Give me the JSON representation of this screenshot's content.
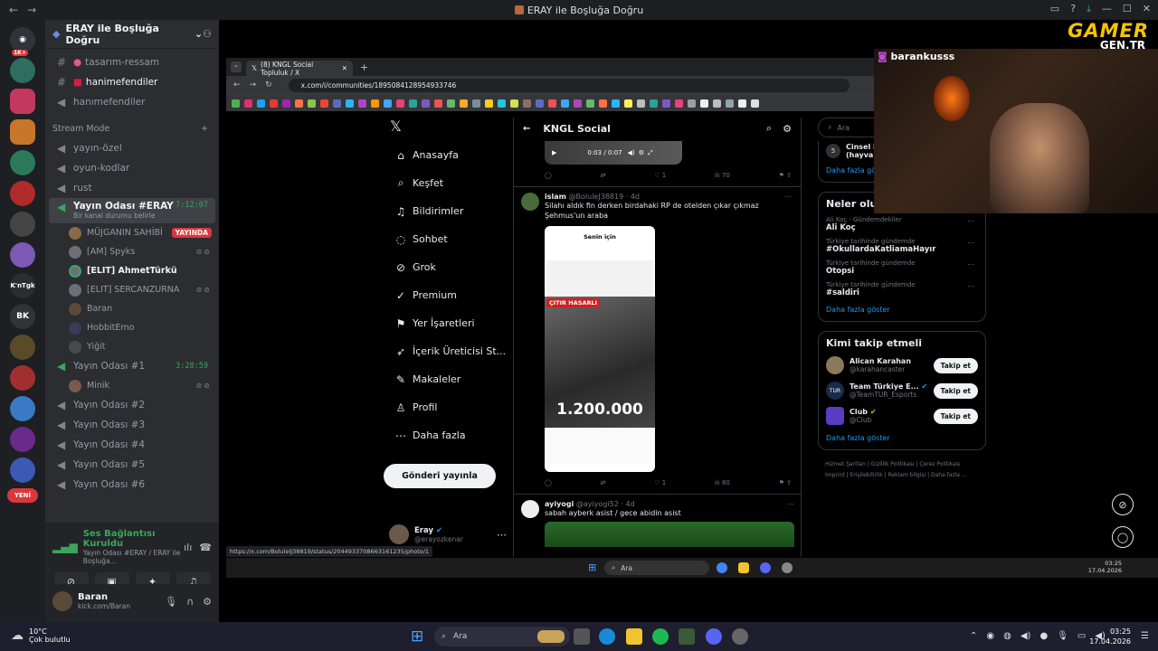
{
  "window": {
    "title": "ERAY ile Boşluğa Doğru"
  },
  "discord": {
    "server_name": "ERAY ile Boşluğa Doğru",
    "server_badges": [
      "1K+",
      "BK",
      "YENİ"
    ],
    "channels": [
      {
        "type": "text",
        "label": "tasarım-ressam"
      },
      {
        "type": "text",
        "label": "hanimefendiler"
      },
      {
        "type": "voice",
        "label": "hanımefendiler"
      }
    ],
    "category": "Stream Mode",
    "stream_channels": [
      {
        "label": "yayın-özel"
      },
      {
        "label": "oyun-kodlar"
      },
      {
        "label": "rust"
      }
    ],
    "voice_rooms": [
      {
        "label": "Yayın Odası #ERAY",
        "time": "7:12:07",
        "sub": "Bir kanal durumu belirle",
        "users": [
          {
            "name": "MÜJGANIN SAHİBİ",
            "live": "YAYINDA"
          },
          {
            "name": "[AM] Spyks"
          },
          {
            "name": "[ELIT] AhmetTürkü"
          },
          {
            "name": "[ELIT] SERCANZURNA"
          },
          {
            "name": "Baran"
          },
          {
            "name": "HobbitEmo"
          },
          {
            "name": "Yiğit"
          }
        ]
      },
      {
        "label": "Yayın Odası #1",
        "time": "3:28:59",
        "users": [
          {
            "name": "Minik"
          }
        ]
      },
      {
        "label": "Yayın Odası #2"
      },
      {
        "label": "Yayın Odası #3"
      },
      {
        "label": "Yayın Odası #4"
      },
      {
        "label": "Yayın Odası #5"
      },
      {
        "label": "Yayın Odası #6"
      }
    ],
    "voice_status": {
      "title": "Ses Bağlantısı Kuruldu",
      "detail": "Yayın Odası #ERAY / ERAY ile Boşluğa..."
    },
    "user": {
      "name": "Baran",
      "status": "kick.com/Baran"
    }
  },
  "browser": {
    "tab_title": "(8) KNGL Social Topluluk / X",
    "url": "x.com/i/communities/1895084128954933746",
    "status_url": "https://x.com/BolulelJ38819/status/2044933708663161235/photo/1"
  },
  "x": {
    "nav": [
      "Anasayfa",
      "Keşfet",
      "Bildirimler",
      "Sohbet",
      "Grok",
      "Premium",
      "Yer İşaretleri",
      "İçerik Üreticisi St...",
      "Makaleler",
      "Profil",
      "Daha fazla"
    ],
    "post_button": "Gönderi yayınla",
    "account": {
      "name": "Eray",
      "handle": "@erayozkenar"
    },
    "community": "KNGL Social",
    "video": {
      "time": "0:03 / 0:07",
      "views": "70",
      "likes": "1"
    },
    "tweets": [
      {
        "author": "islam",
        "handle": "@BoluleJ38819",
        "age": "4d",
        "text": "Silahı aldık fin derken birdahaki RP de otelden çıkar çıkmaz Şehmus'un araba",
        "image_overlay": "ÇITIR HASARLI",
        "image_price": "1.200.000",
        "image_tab": "Senin için",
        "replies": "",
        "likes": "1",
        "views": "80"
      },
      {
        "author": "ayiyogi",
        "handle": "@ayiyogi52",
        "age": "4d",
        "text": "sabah ayberk asist / gece abidin asist"
      }
    ],
    "search_placeholder": "Ara",
    "trending_top": {
      "rank": "5",
      "name": "Cinsel iç...",
      "sub": "(hayvan..."
    },
    "more_label": "Daha fazla göster",
    "whats_happening": "Neler oluyor?",
    "trends": [
      {
        "category": "Ali Koç · Gündemdekiler",
        "name": "Ali Koç"
      },
      {
        "category": "Türkiye tarihinde gündemde",
        "name": "#OkullardaKatliamaHayır"
      },
      {
        "category": "Türkiye tarihinde gündemde",
        "name": "Otopsi"
      },
      {
        "category": "Türkiye tarihinde gündemde",
        "name": "#saldiri"
      }
    ],
    "who_to_follow": "Kimi takip etmeli",
    "follows": [
      {
        "name": "Alican Karahan",
        "handle": "@karahancaster",
        "color": "#8a7a5a"
      },
      {
        "name": "Team Türkiye E...",
        "handle": "@TeamTUR_Esports",
        "color": "#1a2a4a"
      },
      {
        "name": "Club",
        "handle": "@Club",
        "color": "#5b3cc4"
      }
    ],
    "follow_label": "Takip et",
    "footer": [
      "Hizmet Şartları",
      "Gizlilik Politikası",
      "Çerez Politikası",
      "Imprint",
      "Erişilebilirlik",
      "Reklam bilgisi",
      "Daha fazla ..."
    ]
  },
  "stream": {
    "username": "barankusss",
    "logo_top": "GAMER",
    "logo_bottom": "GEN.TR"
  },
  "taskbar": {
    "weather_temp": "10°C",
    "weather_desc": "Çok bulutlu",
    "search": "Ara",
    "time": "03:25",
    "date": "17.04.2026",
    "inner_search": "Ara",
    "inner_time": "03:25",
    "inner_date": "17.04.2026"
  },
  "colors": {
    "discord_bg": "#2b2d31",
    "x_accent": "#1d9bf0",
    "live_red": "#da373c",
    "voice_green": "#3ba55c"
  }
}
